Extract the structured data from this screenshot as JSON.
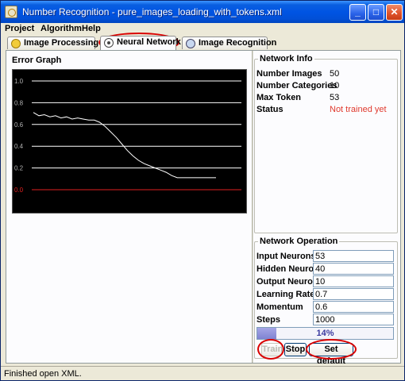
{
  "window": {
    "title": "Number Recognition - pure_images_loading_with_tokens.xml",
    "minimize": "_",
    "maximize": "□",
    "close": "✕"
  },
  "menu": [
    "Project",
    "Algorithm",
    "Help"
  ],
  "tabs": [
    {
      "label": "Image Processing",
      "icon": "image-processing-icon"
    },
    {
      "label": "Neural Network",
      "icon": "neural-network-icon",
      "active": true
    },
    {
      "label": "Image Recognition",
      "icon": "image-recognition-icon"
    }
  ],
  "error_graph": {
    "title": "Error Graph",
    "y_ticks": [
      "1.0",
      "0.8",
      "0.6",
      "0.4",
      "0.2",
      "0.0"
    ],
    "chart_data": {
      "type": "line",
      "ylim": [
        0,
        1.0
      ],
      "grid": true,
      "series": [
        {
          "values": [
            0.71,
            0.68,
            0.69,
            0.67,
            0.68,
            0.66,
            0.67,
            0.65,
            0.66,
            0.65,
            0.64,
            0.64,
            0.62,
            0.58,
            0.53,
            0.48,
            0.42,
            0.36,
            0.31,
            0.27,
            0.24,
            0.22,
            0.2,
            0.18,
            0.16,
            0.13,
            0.11,
            0.11,
            0.11,
            0.11,
            0.11,
            0.11,
            0.11,
            0.11
          ]
        }
      ],
      "colors": {
        "line": "#ffffff",
        "grid": "#ffffff",
        "zero_line": "#e02020",
        "background": "#000000",
        "tick_text": "#b0b0b0",
        "zero_text": "#e02020"
      }
    }
  },
  "network_info": {
    "title": "Network Info",
    "rows": [
      {
        "label": "Number Images",
        "value": "50"
      },
      {
        "label": "Number Categories",
        "value": "10"
      },
      {
        "label": "Max Token",
        "value": "53"
      },
      {
        "label": "Status",
        "value": "Not trained yet"
      }
    ]
  },
  "network_operation": {
    "title": "Network Operation",
    "fields": [
      {
        "label": "Input Neurons",
        "value": "53"
      },
      {
        "label": "Hidden Neurons",
        "value": "40"
      },
      {
        "label": "Output Neurons",
        "value": "10"
      },
      {
        "label": "Learning Rate",
        "value": "0.7"
      },
      {
        "label": "Momentum",
        "value": "0.6"
      },
      {
        "label": "Steps",
        "value": "1000"
      }
    ],
    "progress": {
      "fraction": 0.14,
      "text": "14%"
    },
    "buttons": {
      "train": "Train",
      "stop": "Stop",
      "set_default": "Set default"
    }
  },
  "status_bar": "Finished open XML."
}
